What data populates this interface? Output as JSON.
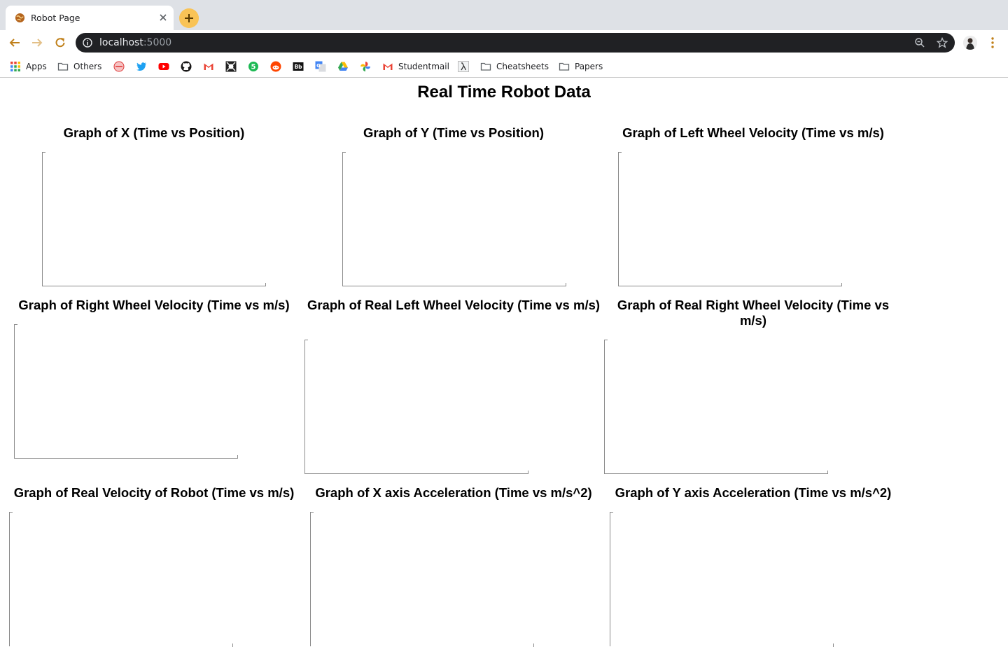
{
  "browser": {
    "tab_title": "Robot Page",
    "url_host": "localhost",
    "url_port": ":5000",
    "bookmarks": [
      {
        "label": "Apps",
        "icon": "apps-grid-icon"
      },
      {
        "label": "Others",
        "icon": "folder-icon"
      },
      {
        "label": "",
        "icon": "site-icon-1"
      },
      {
        "label": "",
        "icon": "twitter-icon"
      },
      {
        "label": "",
        "icon": "youtube-icon"
      },
      {
        "label": "",
        "icon": "github-icon"
      },
      {
        "label": "",
        "icon": "gmail-icon"
      },
      {
        "label": "",
        "icon": "site-icon-2"
      },
      {
        "label": "",
        "icon": "site-icon-3"
      },
      {
        "label": "",
        "icon": "reddit-icon"
      },
      {
        "label": "",
        "icon": "blackboard-icon"
      },
      {
        "label": "",
        "icon": "google-translate-icon"
      },
      {
        "label": "",
        "icon": "google-drive-icon"
      },
      {
        "label": "",
        "icon": "google-photos-icon"
      },
      {
        "label": "Studentmail",
        "icon": "gmail-icon"
      },
      {
        "label": "",
        "icon": "lambda-icon"
      },
      {
        "label": "Cheatsheets",
        "icon": "folder-icon"
      },
      {
        "label": "Papers",
        "icon": "folder-icon"
      }
    ],
    "colors": {
      "tabstrip": "#dee1e6",
      "omnibox": "#202124",
      "newtab": "#f9c356"
    }
  },
  "page": {
    "title": "Real Time Robot Data",
    "graphs": [
      {
        "title": "Graph of X (Time vs Position)"
      },
      {
        "title": "Graph of Y (Time vs Position)"
      },
      {
        "title": "Graph of Left Wheel Velocity (Time vs m/s)"
      },
      {
        "title": "Graph of Right Wheel Velocity (Time vs m/s)"
      },
      {
        "title": "Graph of Real Left Wheel Velocity (Time vs m/s)"
      },
      {
        "title": "Graph of Real Right Wheel Velocity (Time vs m/s)"
      },
      {
        "title": "Graph of Real Velocity of Robot (Time vs m/s)"
      },
      {
        "title": "Graph of X axis Acceleration (Time vs m/s^2)"
      },
      {
        "title": "Graph of Y axis Acceleration (Time vs m/s^2)"
      }
    ]
  }
}
